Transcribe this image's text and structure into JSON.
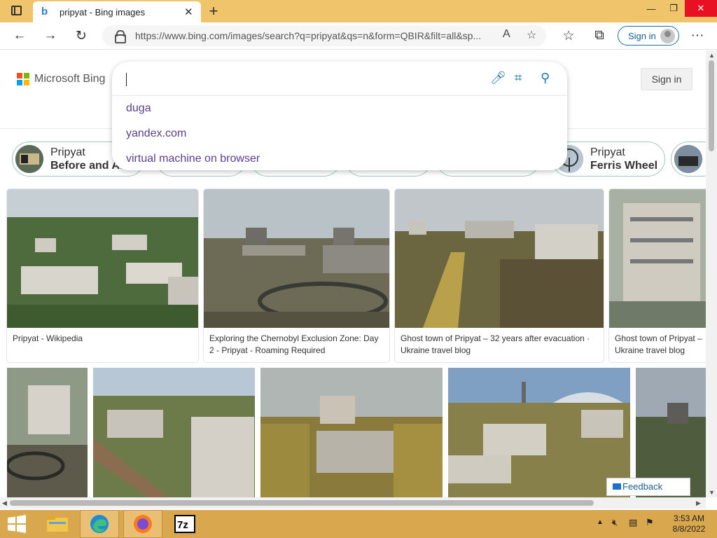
{
  "browser": {
    "tab_title": "pripyat - Bing images",
    "url": "https://www.bing.com/images/search?q=pripyat&qs=n&form=QBIR&filt=all&sp...",
    "signin_label": "Sign in"
  },
  "bing": {
    "logo_text": "Microsoft Bing",
    "signin_label": "Sign in",
    "search_value": "",
    "suggestions": [
      "duga",
      "yandex.com",
      "virtual machine on browser"
    ]
  },
  "chips": [
    {
      "line1": "Pripyat",
      "line2": "Before and Af"
    },
    {
      "line1": "Pripyat",
      "line2": "Ferris Wheel"
    }
  ],
  "results": [
    {
      "caption": "Pripyat - Wikipedia"
    },
    {
      "caption": "Exploring the Chernobyl Exclusion Zone: Day 2 - Pripyat - Roaming Required"
    },
    {
      "caption": "Ghost town of Pripyat – 32 years after evacuation · Ukraine travel blog"
    },
    {
      "caption": "Ghost town of Pripyat – Ukraine travel blog"
    }
  ],
  "feedback_label": "Feedback",
  "taskbar": {
    "time": "3:53 AM",
    "date": "8/8/2022"
  },
  "colors": {
    "titlebar": "#f0c46a",
    "taskbar": "#d9a74e",
    "accent": "#1a7aa5"
  }
}
